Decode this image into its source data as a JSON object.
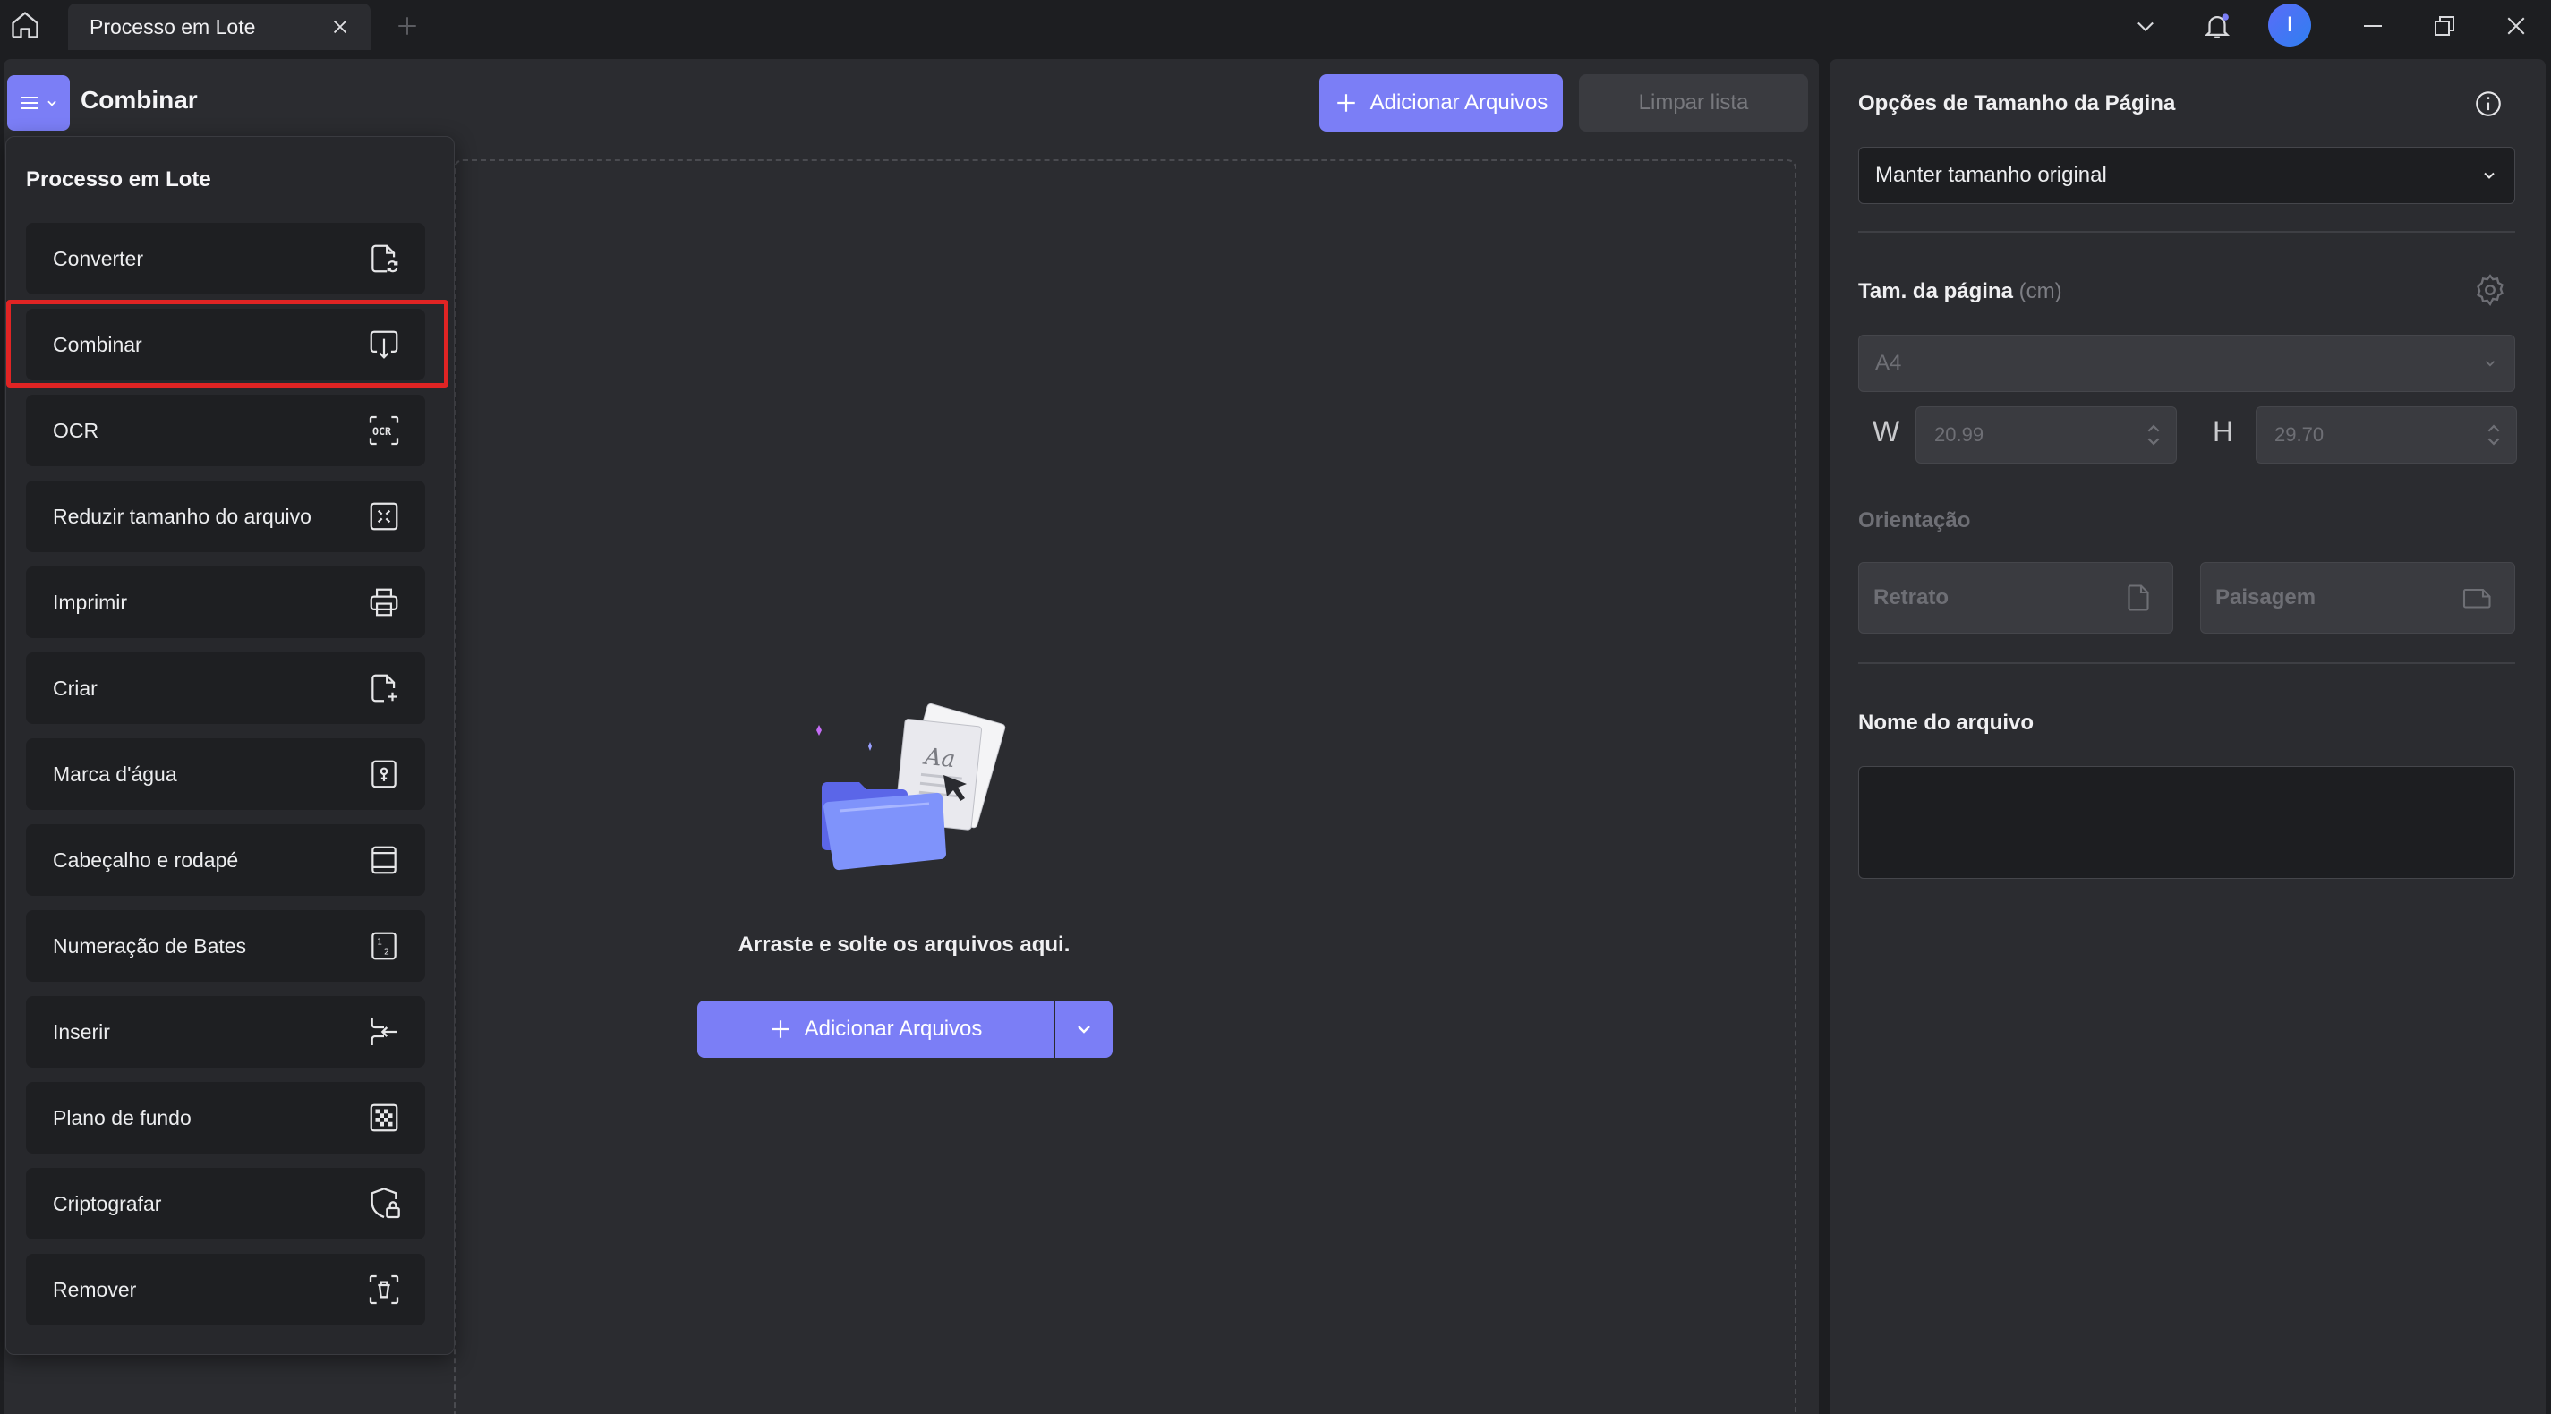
{
  "tab": {
    "title": "Processo em Lote"
  },
  "user": {
    "initial": "I"
  },
  "header": {
    "title": "Combinar",
    "add_files": "Adicionar Arquivos",
    "clear_list": "Limpar lista"
  },
  "menu": {
    "title": "Processo em Lote",
    "items": [
      {
        "label": "Converter",
        "icon": "convert-icon"
      },
      {
        "label": "Combinar",
        "icon": "combine-icon"
      },
      {
        "label": "OCR",
        "icon": "ocr-icon"
      },
      {
        "label": "Reduzir tamanho do arquivo",
        "icon": "compress-icon"
      },
      {
        "label": "Imprimir",
        "icon": "print-icon"
      },
      {
        "label": "Criar",
        "icon": "create-icon"
      },
      {
        "label": "Marca d'água",
        "icon": "watermark-icon"
      },
      {
        "label": "Cabeçalho e rodapé",
        "icon": "header-footer-icon"
      },
      {
        "label": "Numeração de Bates",
        "icon": "bates-icon"
      },
      {
        "label": "Inserir",
        "icon": "insert-icon"
      },
      {
        "label": "Plano de fundo",
        "icon": "background-icon"
      },
      {
        "label": "Criptografar",
        "icon": "encrypt-icon"
      },
      {
        "label": "Remover",
        "icon": "remove-icon"
      }
    ],
    "selected": "Combinar"
  },
  "dropzone": {
    "text": "Arraste e solte os arquivos aqui.",
    "add_files": "Adicionar Arquivos"
  },
  "right_panel": {
    "page_size_options_title": "Opções de Tamanho da Página",
    "page_size_option_value": "Manter tamanho original",
    "page_size_title": "Tam. da página",
    "page_size_unit": "(cm)",
    "paper_value": "A4",
    "width_label": "W",
    "width_value": "20.99",
    "height_label": "H",
    "height_value": "29.70",
    "orientation_title": "Orientação",
    "portrait": "Retrato",
    "landscape": "Paisagem",
    "filename_title": "Nome do arquivo",
    "filename_value": ""
  },
  "colors": {
    "accent": "#7b7ef6",
    "highlight": "#e02424",
    "panel": "#2b2c30",
    "background": "#1d1e21"
  }
}
